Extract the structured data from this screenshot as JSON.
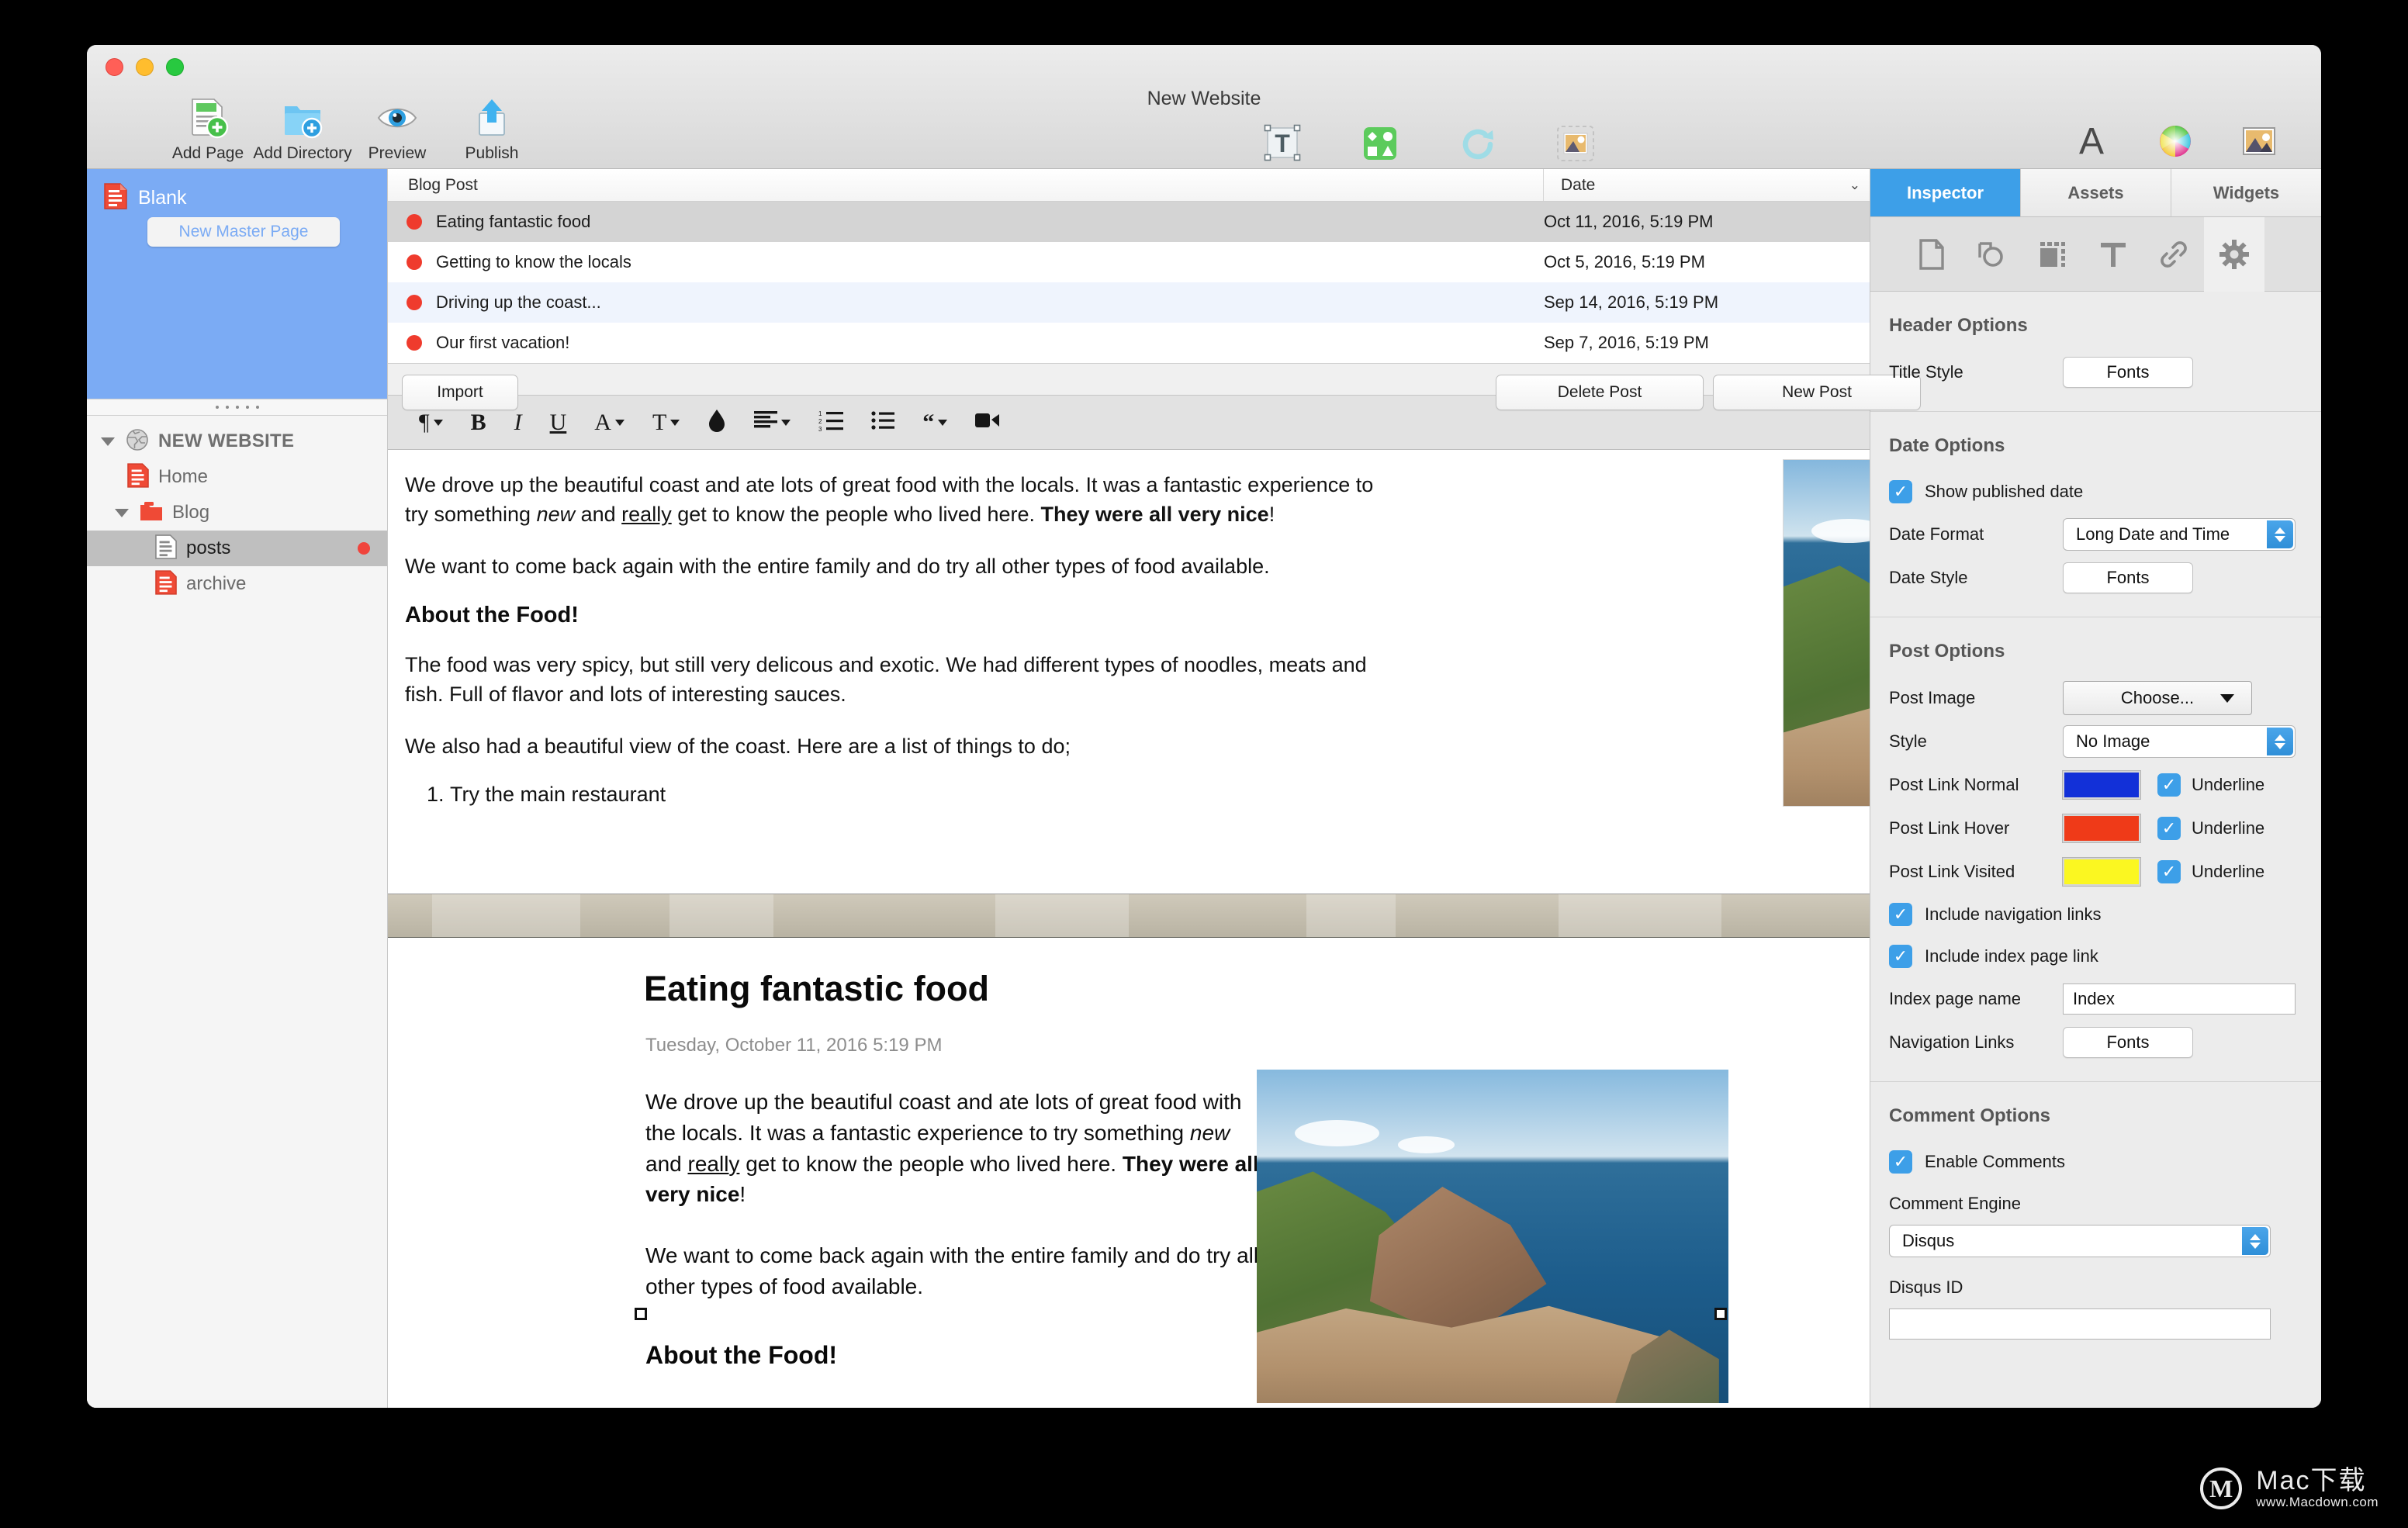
{
  "window": {
    "title": "New Website"
  },
  "toolbar": {
    "left": [
      {
        "label": "Add Page",
        "icon": "add-page-icon",
        "disabled": false
      },
      {
        "label": "Add Directory",
        "icon": "add-directory-icon",
        "disabled": false
      },
      {
        "label": "Preview",
        "icon": "preview-eye-icon",
        "disabled": false
      },
      {
        "label": "Publish",
        "icon": "publish-upload-icon",
        "disabled": false
      }
    ],
    "center": [
      {
        "label": "TextBox",
        "icon": "textbox-icon",
        "disabled": false
      },
      {
        "label": "Shapes",
        "icon": "shapes-icon",
        "disabled": false
      },
      {
        "label": "Rotate",
        "icon": "rotate-icon",
        "disabled": true
      },
      {
        "label": "Mask",
        "icon": "mask-icon",
        "disabled": true
      }
    ],
    "right": [
      {
        "label": "Fonts",
        "icon": "fonts-a-icon",
        "disabled": false
      },
      {
        "label": "Colors",
        "icon": "colors-wheel-icon",
        "disabled": false
      },
      {
        "label": "Media",
        "icon": "media-image-icon",
        "disabled": false
      }
    ]
  },
  "sidebar": {
    "master": {
      "page_label": "Blank",
      "new_button": "New Master Page"
    },
    "tree": [
      {
        "label": "NEW WEBSITE",
        "icon": "globe-icon",
        "level": 0,
        "twisty": "open",
        "selected": false,
        "dirty": false
      },
      {
        "label": "Home",
        "icon": "page-icon",
        "level": 1,
        "twisty": "none",
        "selected": false,
        "dirty": false
      },
      {
        "label": "Blog",
        "icon": "folder-icon",
        "level": 1,
        "twisty": "open",
        "selected": false,
        "dirty": false
      },
      {
        "label": "posts",
        "icon": "page-icon-grey",
        "level": 2,
        "twisty": "none",
        "selected": true,
        "dirty": true
      },
      {
        "label": "archive",
        "icon": "page-icon",
        "level": 2,
        "twisty": "none",
        "selected": false,
        "dirty": false
      }
    ]
  },
  "post_list": {
    "columns": {
      "title": "Blog Post",
      "date": "Date"
    },
    "sort_indicator": "⌄",
    "rows": [
      {
        "title": "Eating fantastic food",
        "date": "Oct 11, 2016, 5:19 PM",
        "state": "selected",
        "bullet": "#ef3b2d"
      },
      {
        "title": "Getting to know the locals",
        "date": "Oct 5, 2016, 5:19 PM",
        "state": "normal",
        "bullet": "#ef3b2d"
      },
      {
        "title": "Driving up the coast...",
        "date": "Sep 14, 2016, 5:19 PM",
        "state": "highlight",
        "bullet": "#ef3b2d"
      },
      {
        "title": "Our first vacation!",
        "date": "Sep 7, 2016, 5:19 PM",
        "state": "normal",
        "bullet": "#ef3b2d"
      }
    ],
    "buttons": {
      "import": "Import",
      "delete": "Delete Post",
      "new": "New Post"
    }
  },
  "format_bar": [
    {
      "name": "paragraph-style-button",
      "glyph": "¶",
      "caret": true
    },
    {
      "name": "bold-button",
      "glyph": "B",
      "caret": false
    },
    {
      "name": "italic-button",
      "glyph": "I",
      "caret": false
    },
    {
      "name": "underline-button",
      "glyph": "U",
      "caret": false
    },
    {
      "name": "font-family-button",
      "glyph": "A",
      "caret": true
    },
    {
      "name": "font-size-button",
      "glyph": "T",
      "caret": true
    },
    {
      "name": "text-color-button",
      "glyph": "⬟",
      "caret": false
    },
    {
      "name": "align-button",
      "glyph": "≡",
      "caret": true
    },
    {
      "name": "ordered-list-button",
      "glyph": "≣",
      "caret": false
    },
    {
      "name": "unordered-list-button",
      "glyph": "•",
      "caret": false
    },
    {
      "name": "blockquote-button",
      "glyph": "“",
      "caret": true
    },
    {
      "name": "video-button",
      "glyph": "▶",
      "caret": false
    }
  ],
  "editor": {
    "p1_a": "We drove up the beautiful coast and ate lots of great food with the locals. It was a fantastic experience to try something ",
    "p1_em": "new",
    "p1_b": " and ",
    "p1_u": "really",
    "p1_c": " get to know the people who lived here. ",
    "p1_strong": "They were all very nice",
    "p1_d": "!",
    "p2": "We want to come back again with the entire family and do try all other types of food available.",
    "h3": "About the Food!",
    "p3": "The food was very spicy, but still very delicous and exotic. We had different types of noodles, meats and fish. Full of flavor and lots of interesting sauces.",
    "p4": "We also had a beautiful view of the coast. Here are a list of things to do;",
    "li1": "Try the main restaurant",
    "image_alt": "coastal-cliff-photo"
  },
  "preview": {
    "title": "Eating fantastic food",
    "date": "Tuesday, October 11, 2016 5:19 PM",
    "p1_a": "We drove up the beautiful coast and ate lots of great food with the locals. It was a fantastic experience to try something ",
    "p1_em": "new",
    "p1_b": " and ",
    "p1_u": "really",
    "p1_c": " get to know the people who lived here. ",
    "p1_strong": "They were all very nice",
    "p1_d": "!",
    "p2": "We want to come back again with the entire family and do try all other types of food available.",
    "h3": "About the Food!",
    "image_alt": "coastal-cliff-photo"
  },
  "inspector": {
    "tabs": [
      {
        "label": "Inspector",
        "active": true
      },
      {
        "label": "Assets",
        "active": false
      },
      {
        "label": "Widgets",
        "active": false
      }
    ],
    "icons": [
      {
        "name": "page-inspector-icon",
        "active": false
      },
      {
        "name": "shape-inspector-icon",
        "active": false
      },
      {
        "name": "image-inspector-icon",
        "active": false
      },
      {
        "name": "text-inspector-icon",
        "active": false
      },
      {
        "name": "link-inspector-icon",
        "active": false
      },
      {
        "name": "settings-gear-icon",
        "active": true
      }
    ],
    "header_options": {
      "title": "Header Options",
      "title_style_label": "Title Style",
      "title_style_button": "Fonts"
    },
    "date_options": {
      "title": "Date Options",
      "show_published_date_label": "Show published date",
      "show_published_date_checked": true,
      "date_format_label": "Date Format",
      "date_format_value": "Long Date and Time",
      "date_style_label": "Date Style",
      "date_style_button": "Fonts"
    },
    "post_options": {
      "title": "Post Options",
      "post_image_label": "Post Image",
      "post_image_button": "Choose...",
      "style_label": "Style",
      "style_value": "No Image",
      "links": [
        {
          "label": "Post Link Normal",
          "color": "#1230d8",
          "underline_label": "Underline",
          "underline": true
        },
        {
          "label": "Post Link Hover",
          "color": "#ef3a18",
          "underline_label": "Underline",
          "underline": true
        },
        {
          "label": "Post Link Visited",
          "color": "#fbf721",
          "underline_label": "Underline",
          "underline": true
        }
      ],
      "include_navigation_links_label": "Include navigation links",
      "include_navigation_links_checked": true,
      "include_index_page_link_label": "Include index page link",
      "include_index_page_link_checked": true,
      "index_page_name_label": "Index page name",
      "index_page_name_value": "Index",
      "navigation_links_label": "Navigation Links",
      "navigation_links_button": "Fonts"
    },
    "comment_options": {
      "title": "Comment Options",
      "enable_comments_label": "Enable Comments",
      "enable_comments_checked": true,
      "comment_engine_label": "Comment Engine",
      "comment_engine_value": "Disqus",
      "disqus_id_label": "Disqus ID",
      "disqus_id_value": ""
    }
  },
  "watermark": {
    "mark": "M",
    "main": "Mac下载",
    "sub": "www.Macdown.com"
  }
}
